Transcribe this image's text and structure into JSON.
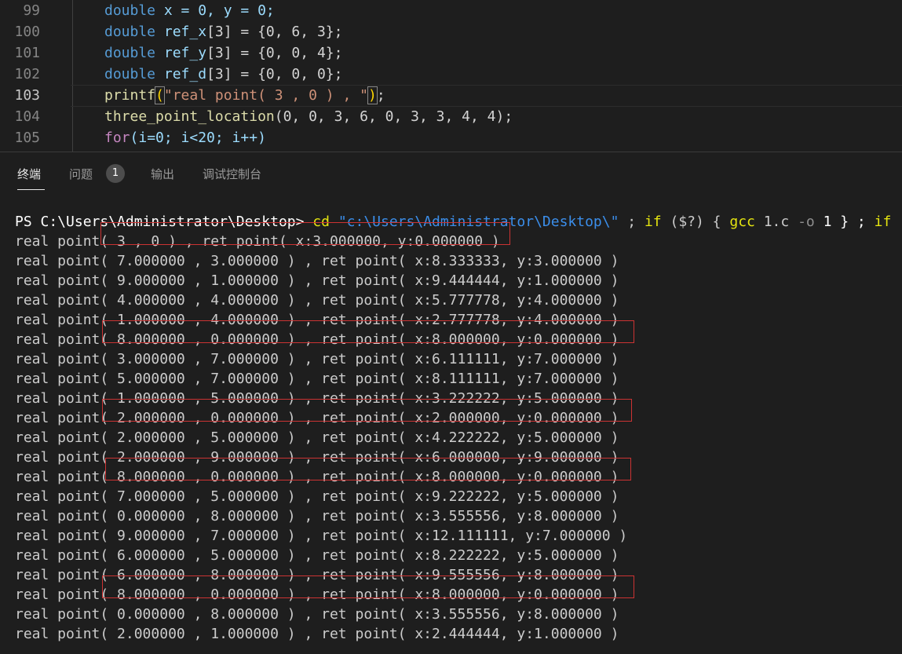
{
  "editor": {
    "lines": [
      {
        "num": "99"
      },
      {
        "num": "100"
      },
      {
        "num": "101"
      },
      {
        "num": "102"
      },
      {
        "num": "103"
      },
      {
        "num": "104"
      },
      {
        "num": "105"
      }
    ],
    "code": {
      "l99": {
        "type": "double",
        "rest": " x = 0, y = 0;"
      },
      "l100": {
        "type": "double",
        "name": " ref_x",
        "rest": "[3] = {0, 6, 3};"
      },
      "l101": {
        "type": "double",
        "name": " ref_y",
        "rest": "[3] = {0, 0, 4};"
      },
      "l102": {
        "type": "double",
        "name": " ref_d",
        "rest": "[3] = {0, 0, 0};"
      },
      "l103": {
        "fn": "printf",
        "open": "(",
        "str": "\"real point( 3 , 0 ) , \"",
        "close": ")",
        "end": ";"
      },
      "l104": {
        "fn": "three_point_location",
        "args": "(0, 0, 3, 6, 0, 3, 3, 4, 4);"
      },
      "l105": {
        "kw": "for",
        "rest": "(i=0; i<20; i++)"
      }
    }
  },
  "panel": {
    "tabs": [
      {
        "label": "终端"
      },
      {
        "label": "问题"
      },
      {
        "label": "输出"
      },
      {
        "label": "调试控制台"
      }
    ],
    "problems_count": "1"
  },
  "terminal": {
    "prompt": "PS C:\\Users\\Administrator\\Desktop> ",
    "cmd": "cd",
    "path": " \"c:\\Users\\Administrator\\Desktop\\\"",
    "after_path": " ; ",
    "if1": "if",
    "cond": " ($?) { ",
    "gcc": "gcc",
    "gcc_args": " 1.c ",
    "flag": "-o",
    "out": " 1 } ; ",
    "if2": "if",
    "output": [
      "real point( 3 , 0 ) , ret point( x:3.000000, y:0.000000 )",
      "real point( 7.000000 , 3.000000 ) , ret point( x:8.333333, y:3.000000 )",
      "real point( 9.000000 , 1.000000 ) , ret point( x:9.444444, y:1.000000 )",
      "real point( 4.000000 , 4.000000 ) , ret point( x:5.777778, y:4.000000 )",
      "real point( 1.000000 , 4.000000 ) , ret point( x:2.777778, y:4.000000 )",
      "real point( 8.000000 , 0.000000 ) , ret point( x:8.000000, y:0.000000 )",
      "real point( 3.000000 , 7.000000 ) , ret point( x:6.111111, y:7.000000 )",
      "real point( 5.000000 , 7.000000 ) , ret point( x:8.111111, y:7.000000 )",
      "real point( 1.000000 , 5.000000 ) , ret point( x:3.222222, y:5.000000 )",
      "real point( 2.000000 , 0.000000 ) , ret point( x:2.000000, y:0.000000 )",
      "real point( 2.000000 , 5.000000 ) , ret point( x:4.222222, y:5.000000 )",
      "real point( 2.000000 , 9.000000 ) , ret point( x:6.000000, y:9.000000 )",
      "real point( 8.000000 , 0.000000 ) , ret point( x:8.000000, y:0.000000 )",
      "real point( 7.000000 , 5.000000 ) , ret point( x:9.222222, y:5.000000 )",
      "real point( 0.000000 , 8.000000 ) , ret point( x:3.555556, y:8.000000 )",
      "real point( 9.000000 , 7.000000 ) , ret point( x:12.111111, y:7.000000 )",
      "real point( 6.000000 , 5.000000 ) , ret point( x:8.222222, y:5.000000 )",
      "real point( 6.000000 , 8.000000 ) , ret point( x:9.555556, y:8.000000 )",
      "real point( 8.000000 , 0.000000 ) , ret point( x:8.000000, y:0.000000 )",
      "real point( 0.000000 , 8.000000 ) , ret point( x:3.555556, y:8.000000 )",
      "real point( 2.000000 , 1.000000 ) , ret point( x:2.444444, y:1.000000 )"
    ]
  },
  "colors": {
    "highlight_box": "#cc3333",
    "background": "#1e1e1e"
  }
}
